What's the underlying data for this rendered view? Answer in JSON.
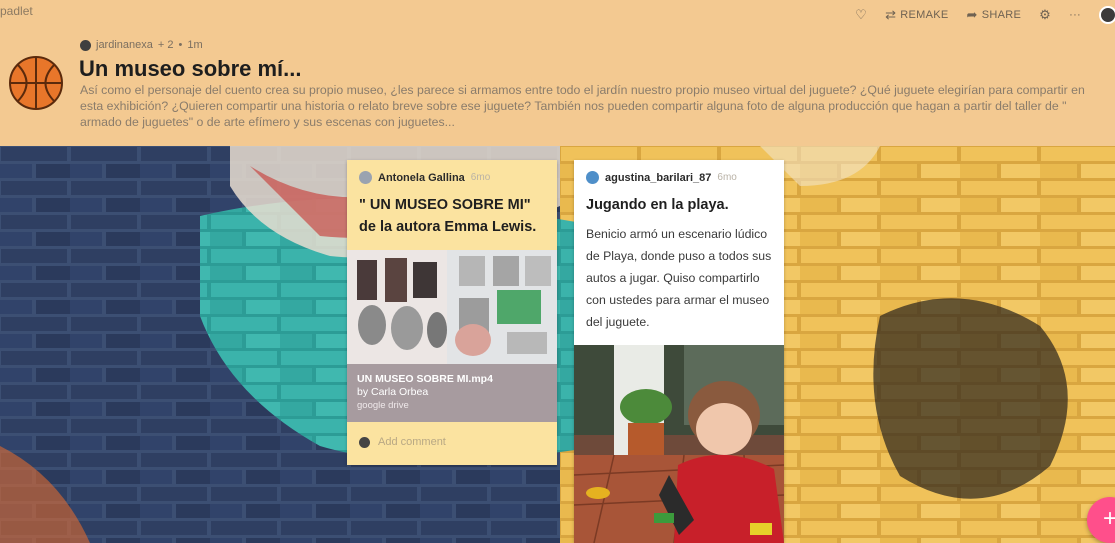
{
  "brand": "padlet",
  "topbar": {
    "heart_icon": "heart-icon",
    "remake_label": "REMAKE",
    "share_label": "SHARE",
    "settings_icon": "gear-icon",
    "more_label": "···"
  },
  "header": {
    "author": "jardinanexa",
    "likes": "+ 2",
    "time": "1m",
    "separator": "•",
    "title": "Un museo sobre mí...",
    "description": "Así como el personaje del cuento crea su propio museo, ¿les parece si armamos entre todo el jardín nuestro propio museo virtual del juguete? ¿Qué juguete elegirían para compartir en esta exhibición? ¿Quieren compartir una historia o relato breve sobre ese juguete? También nos pueden compartir alguna foto de alguna producción que hagan a partir del taller de \" armado de juguetes\" o de arte efímero y sus escenas con juguetes..."
  },
  "posts": [
    {
      "author": "Antonela Gallina",
      "time": "6mo",
      "title": "\" UN MUSEO SOBRE MI\" de la autora Emma Lewis.",
      "attachment": {
        "title": "UN MUSEO SOBRE MI.mp4",
        "by": "by Carla Orbea",
        "source": "google drive"
      },
      "comment_placeholder": "Add comment"
    },
    {
      "author": "agustina_barilari_87",
      "time": "6mo",
      "title": "Jugando en la playa.",
      "body": "Benicio armó un escenario lúdico de  Playa, donde puso a todos sus autos a jugar. Quiso compartirlo con ustedes para armar el museo del juguete."
    }
  ],
  "fab_label": "+",
  "colors": {
    "header_bg": "#f3c991",
    "card1_bg": "#fbe3a0",
    "fab": "#ff4f8b"
  }
}
